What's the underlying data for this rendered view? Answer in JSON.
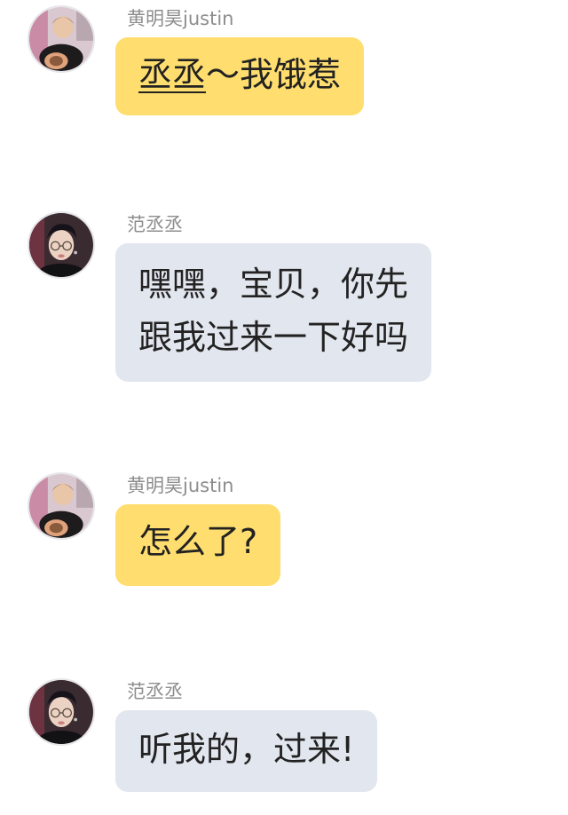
{
  "messages": [
    {
      "sender": {
        "name_underlined": "",
        "name": "黄明昊justin"
      },
      "text_underlined": "丞丞",
      "text": "～我饿惹",
      "line2": "",
      "bubble_color": "#ffde6f",
      "avatar_icon": "avatar-justin"
    },
    {
      "sender": {
        "name_underlined": "",
        "name": "范丞丞"
      },
      "text_underlined": "",
      "text": "嘿嘿，宝贝，你先",
      "line2": "跟我过来一下好吗",
      "bubble_color": "#e2e6ee",
      "avatar_icon": "avatar-chengcheng"
    },
    {
      "sender": {
        "name_underlined": "",
        "name": "黄明昊justin"
      },
      "text_underlined": "",
      "text": "怎么了?",
      "line2": "",
      "bubble_color": "#ffde6f",
      "avatar_icon": "avatar-justin"
    },
    {
      "sender": {
        "name_underlined": "",
        "name": "范丞丞"
      },
      "text_underlined": "",
      "text": "听我的，过来!",
      "line2": "",
      "bubble_color": "#e2e6ee",
      "avatar_icon": "avatar-chengcheng"
    }
  ]
}
